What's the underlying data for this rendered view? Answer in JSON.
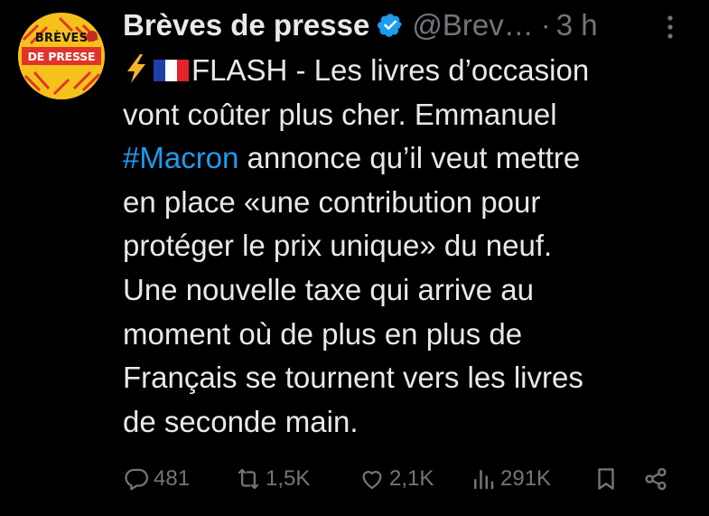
{
  "tweet": {
    "author": {
      "name": "Brèves de presse",
      "handle": "@Brev…",
      "separator": "·",
      "time": "3 h",
      "avatar_text_line1": "BRÈVES",
      "avatar_text_line2": "DE PRESSE",
      "verified_icon": "verified-badge-icon",
      "more_icon": "more-vertical-icon"
    },
    "lines": {
      "l1_text": "FLASH - Les livres d’occasion",
      "l2": "vont coûter plus cher. Emmanuel",
      "l3_hashtag": "#Macron",
      "l3_rest": " annonce qu’il veut mettre",
      "l4": "en place «une contribution pour",
      "l5": "protéger le prix unique» du neuf.",
      "l6": "Une nouvelle taxe qui arrive au",
      "l7": "moment où de plus en plus de",
      "l8": "Français se tournent vers les livres",
      "l9": "de seconde main."
    },
    "emojis": [
      "lightning-emoji",
      "france-flag-emoji"
    ],
    "metrics": {
      "replies": "481",
      "reposts": "1,5K",
      "likes": "2,1K",
      "views": "291K"
    },
    "colors": {
      "background": "#000000",
      "text": "#e7e9ea",
      "secondary": "#71767b",
      "link": "#1d9bf0",
      "verified": "#1d9bf0",
      "avatar": "#f4c21a"
    }
  }
}
